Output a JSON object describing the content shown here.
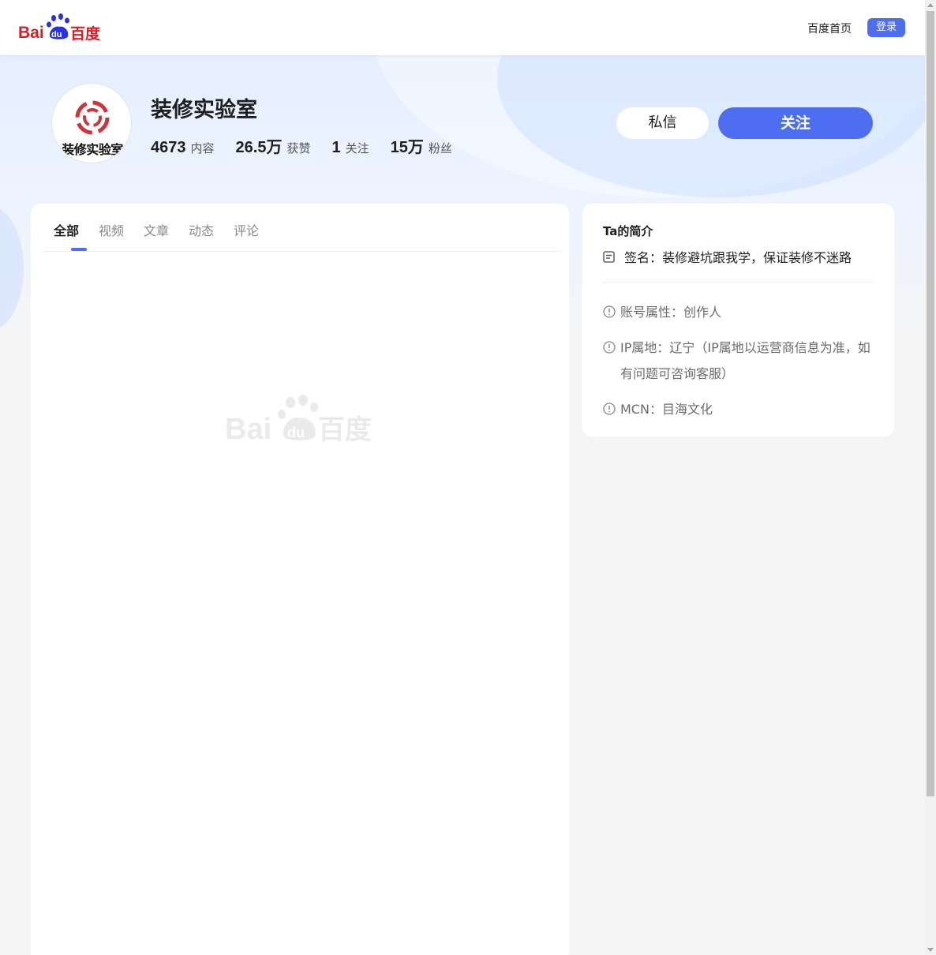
{
  "header": {
    "logo_text_left": "Bai",
    "logo_text_mid": "du",
    "logo_text_right": "百度",
    "home_link": "百度首页",
    "login_label": "登录"
  },
  "profile": {
    "name": "装修实验室",
    "avatar_text": "装修实验室",
    "stats": [
      {
        "value": "4673",
        "label": "内容"
      },
      {
        "value": "26.5万",
        "label": "获赞"
      },
      {
        "value": "1",
        "label": "关注"
      },
      {
        "value": "15万",
        "label": "粉丝"
      }
    ],
    "message_label": "私信",
    "follow_label": "关注"
  },
  "tabs": [
    "全部",
    "视频",
    "文章",
    "动态",
    "评论"
  ],
  "intro": {
    "title": "Ta的简介",
    "signature": "签名：装修避坑跟我学，保证装修不迷路",
    "account_type": "账号属性：创作人",
    "ip_location": "IP属地：辽宁（IP属地以运营商信息为准，如有问题可咨询客服）",
    "mcn": "MCN：目海文化"
  },
  "colors": {
    "accent": "#4e6ef2",
    "baidu_red": "#de1c24",
    "baidu_blue": "#2932e1"
  }
}
